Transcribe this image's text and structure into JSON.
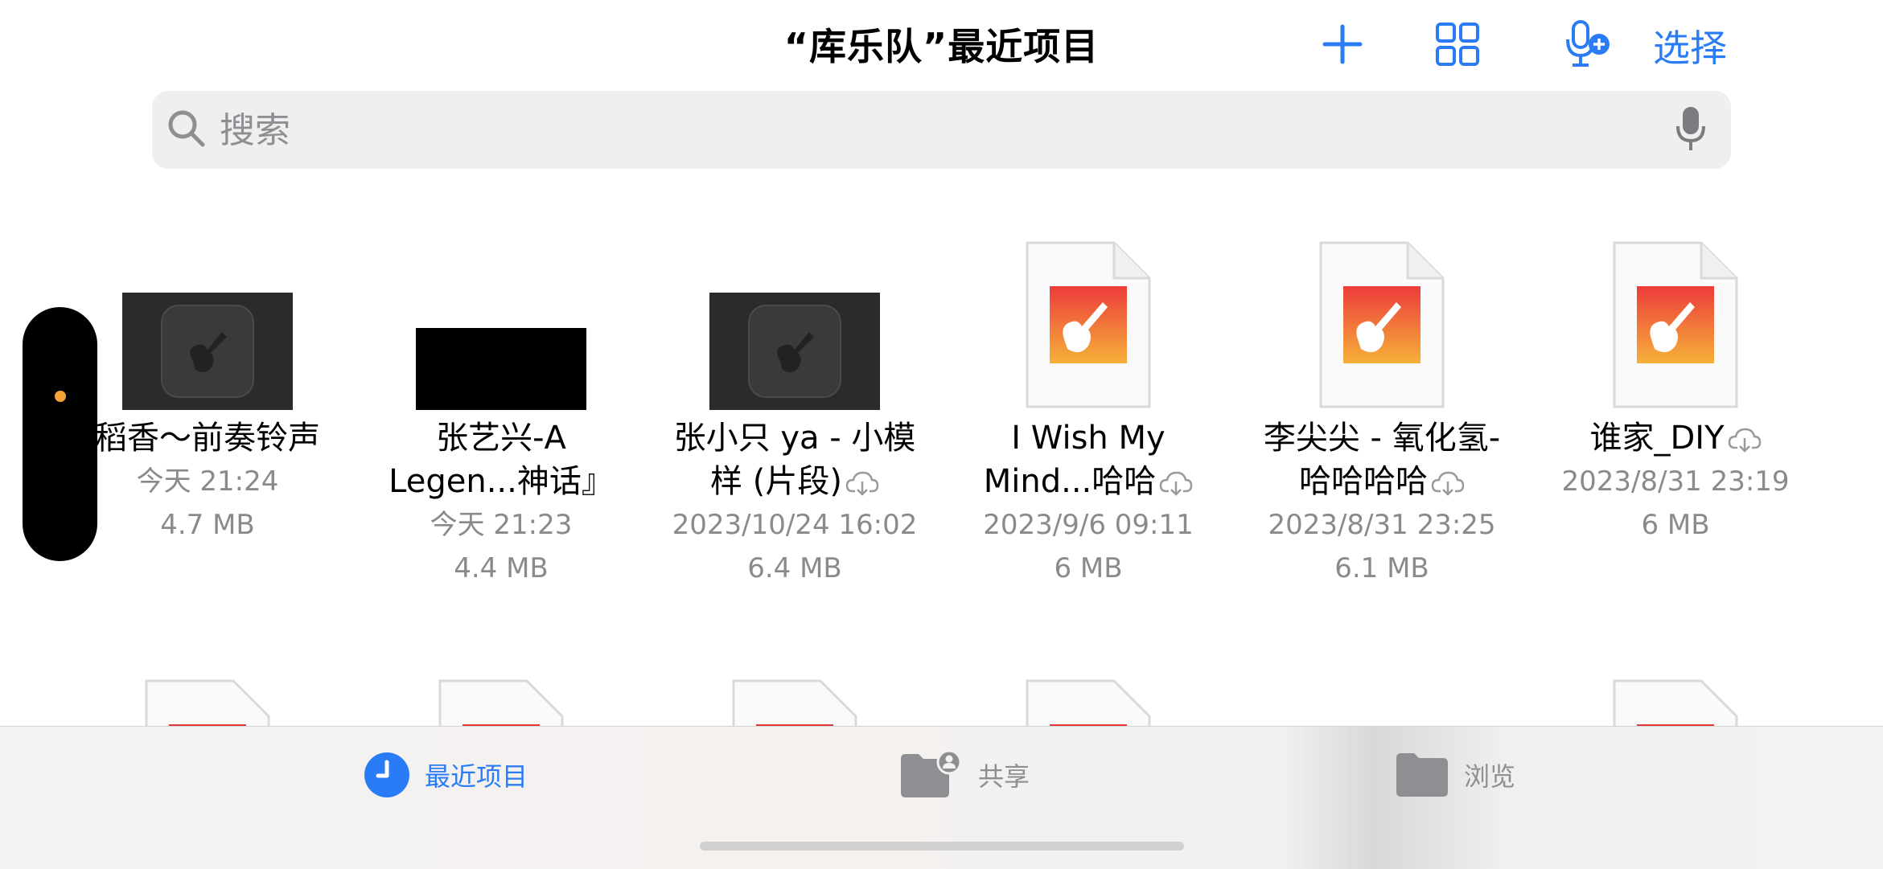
{
  "header": {
    "title": "“库乐队”最近项目",
    "select_label": "选择",
    "icons": [
      "plus-icon",
      "grid-view-icon",
      "mic-add-icon"
    ],
    "accent_color": "#2a7cf6"
  },
  "search": {
    "placeholder": "搜索",
    "value": ""
  },
  "files": [
    {
      "name": "稻香～前奏铃声",
      "date": "今天 21:24",
      "size": "4.7 MB",
      "thumb": "dark-garageband",
      "cloud": false
    },
    {
      "name": "张艺兴-A Legen...神话』",
      "date": "今天 21:23",
      "size": "4.4 MB",
      "thumb": "black",
      "cloud": false
    },
    {
      "name": "张小只 ya - 小模样 (片段)",
      "date": "2023/10/24 16:02",
      "size": "6.4 MB",
      "thumb": "dark-garageband",
      "cloud": true
    },
    {
      "name": "I Wish My Mind...哈哈",
      "date": "2023/9/6 09:11",
      "size": "6 MB",
      "thumb": "doc-garageband",
      "cloud": true
    },
    {
      "name": "李尖尖 - 氧化氢-哈哈哈哈",
      "date": "2023/8/31 23:25",
      "size": "6.1 MB",
      "thumb": "doc-garageband",
      "cloud": true
    },
    {
      "name": "谁家_DIY",
      "date": "2023/8/31 23:19",
      "size": "6 MB",
      "thumb": "doc-garageband",
      "cloud": true
    }
  ],
  "tabs": [
    {
      "label": "最近项目",
      "icon": "clock-icon",
      "active": true
    },
    {
      "label": "共享",
      "icon": "shared-folder-icon",
      "active": false
    },
    {
      "label": "浏览",
      "icon": "folder-icon",
      "active": false
    }
  ]
}
